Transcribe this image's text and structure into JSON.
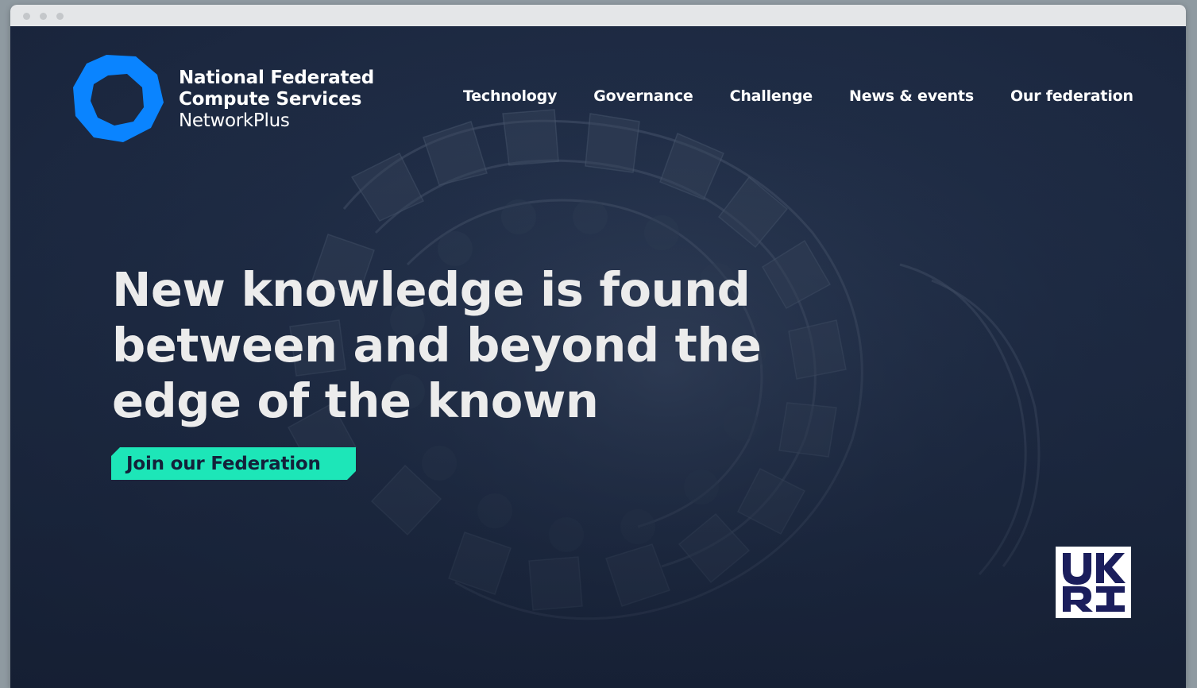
{
  "window": {
    "controls": [
      "dot",
      "dot",
      "dot"
    ]
  },
  "header": {
    "brand": {
      "line1": "National Federated",
      "line2": "Compute Services",
      "line3": "NetworkPlus",
      "logo_icon": "octagon-ring-logo",
      "logo_color": "#0a84ff"
    },
    "nav": [
      {
        "label": "Technology"
      },
      {
        "label": "Governance"
      },
      {
        "label": "Challenge"
      },
      {
        "label": "News & events"
      },
      {
        "label": "Our federation"
      }
    ]
  },
  "hero": {
    "headline_line1": "New knowledge is found",
    "headline_line2": "between and beyond the",
    "headline_line3": "edge of the known",
    "cta_label": "Join our Federation",
    "cta_color": "#1de6b8",
    "background_image": "dark blue sculptural spiral shell"
  },
  "footer_logo": {
    "text": "UKRI",
    "icon": "ukri-logo",
    "color": "#1b1e5c"
  }
}
